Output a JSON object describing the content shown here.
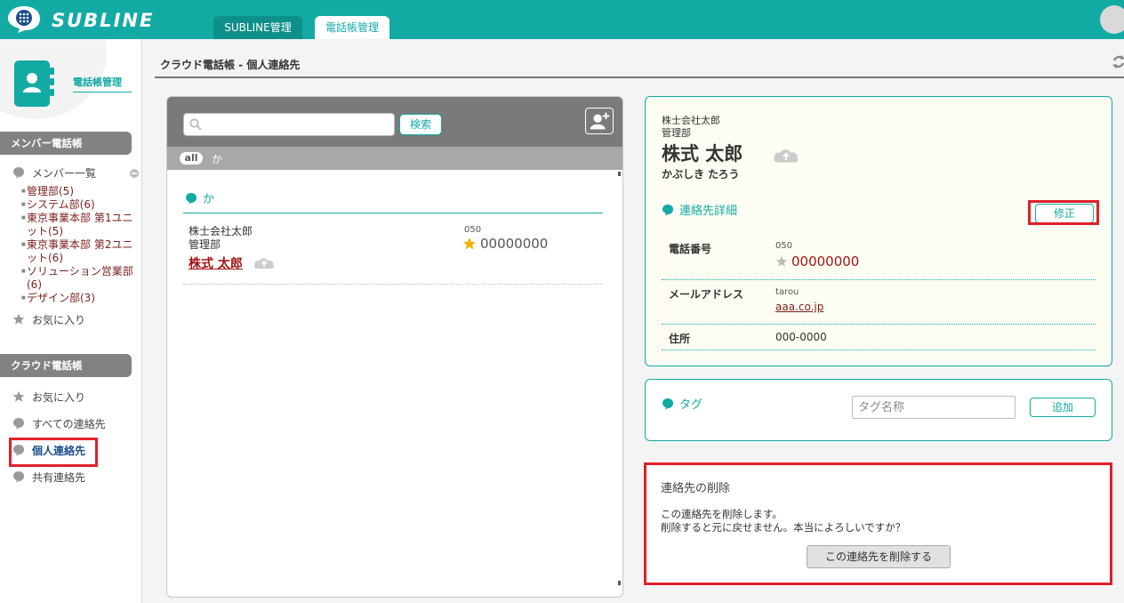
{
  "app": {
    "name": "SUBLINE"
  },
  "tabs": [
    {
      "label": "SUBLINE管理"
    },
    {
      "label": "電話帳管理"
    }
  ],
  "sidebar": {
    "title": "電話帳管理",
    "member_section": "メンバー電話帳",
    "member_list": "メンバー一覧",
    "departments": [
      {
        "label": "管理部(5)"
      },
      {
        "label": "システム部(6)"
      },
      {
        "label": "東京事業本部 第1ユニット(5)"
      },
      {
        "label": "東京事業本部 第2ユニット(6)"
      },
      {
        "label": "ソリューション営業部(6)"
      },
      {
        "label": "デザイン部(3)"
      }
    ],
    "member_favorites": "お気に入り",
    "cloud_section": "クラウド電話帳",
    "cloud_items": [
      {
        "label": "お気に入り"
      },
      {
        "label": "すべての連絡先"
      },
      {
        "label": "個人連絡先"
      },
      {
        "label": "共有連絡先"
      }
    ]
  },
  "breadcrumb": "クラウド電話帳 - 個人連絡先",
  "list": {
    "search_placeholder": "",
    "search_button": "検索",
    "filter_all": "all",
    "filter_kana": "か",
    "group_label": "か",
    "contact": {
      "company": "株士会社太郎",
      "department": "管理部",
      "name": "株式 太郎",
      "phone_label": "050",
      "phone": "00000000"
    }
  },
  "detail": {
    "company": "株士会社太郎",
    "department": "管理部",
    "name": "株式 太郎",
    "kana": "かぶしき たろう",
    "section_title": "連絡先詳細",
    "edit_button": "修正",
    "phone_label": "電話番号",
    "phone_sub": "050",
    "phone_value": "00000000",
    "email_label": "メールアドレス",
    "email_sub": "tarou",
    "email_value": "aaa.co.jp",
    "address_label": "住所",
    "address_value": "000-0000"
  },
  "tag": {
    "title": "タグ",
    "placeholder": "タグ名称",
    "add_button": "追加"
  },
  "delete": {
    "title": "連絡先の削除",
    "line1": "この連絡先を削除します。",
    "line2": "削除すると元に戻せません。本当によろしいですか？",
    "button": "この連絡先を削除する"
  },
  "colors": {
    "brand": "#13aaa4",
    "highlight": "#e0202a",
    "link": "#a31414"
  }
}
